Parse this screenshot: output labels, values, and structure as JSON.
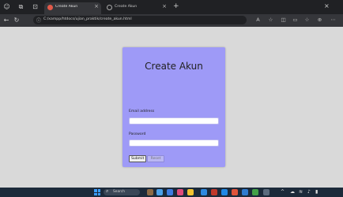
{
  "browser": {
    "tabs": [
      {
        "title": "Create Akun",
        "active": true
      },
      {
        "title": "Create Akun",
        "active": false
      }
    ],
    "address": "C:/xampp/htdocs/ujian_praktik/create_akun.html"
  },
  "form": {
    "title": "Create Akun",
    "email_label": "Email address",
    "email_value": "",
    "password_label": "Password",
    "password_value": "",
    "submit_label": "Submit",
    "reset_label": "Reset"
  },
  "taskbar": {
    "search_placeholder": "Search"
  },
  "colors": {
    "card": "#9e9af7",
    "page_bg": "#d9d9d9",
    "browser_chrome": "#35363a"
  }
}
